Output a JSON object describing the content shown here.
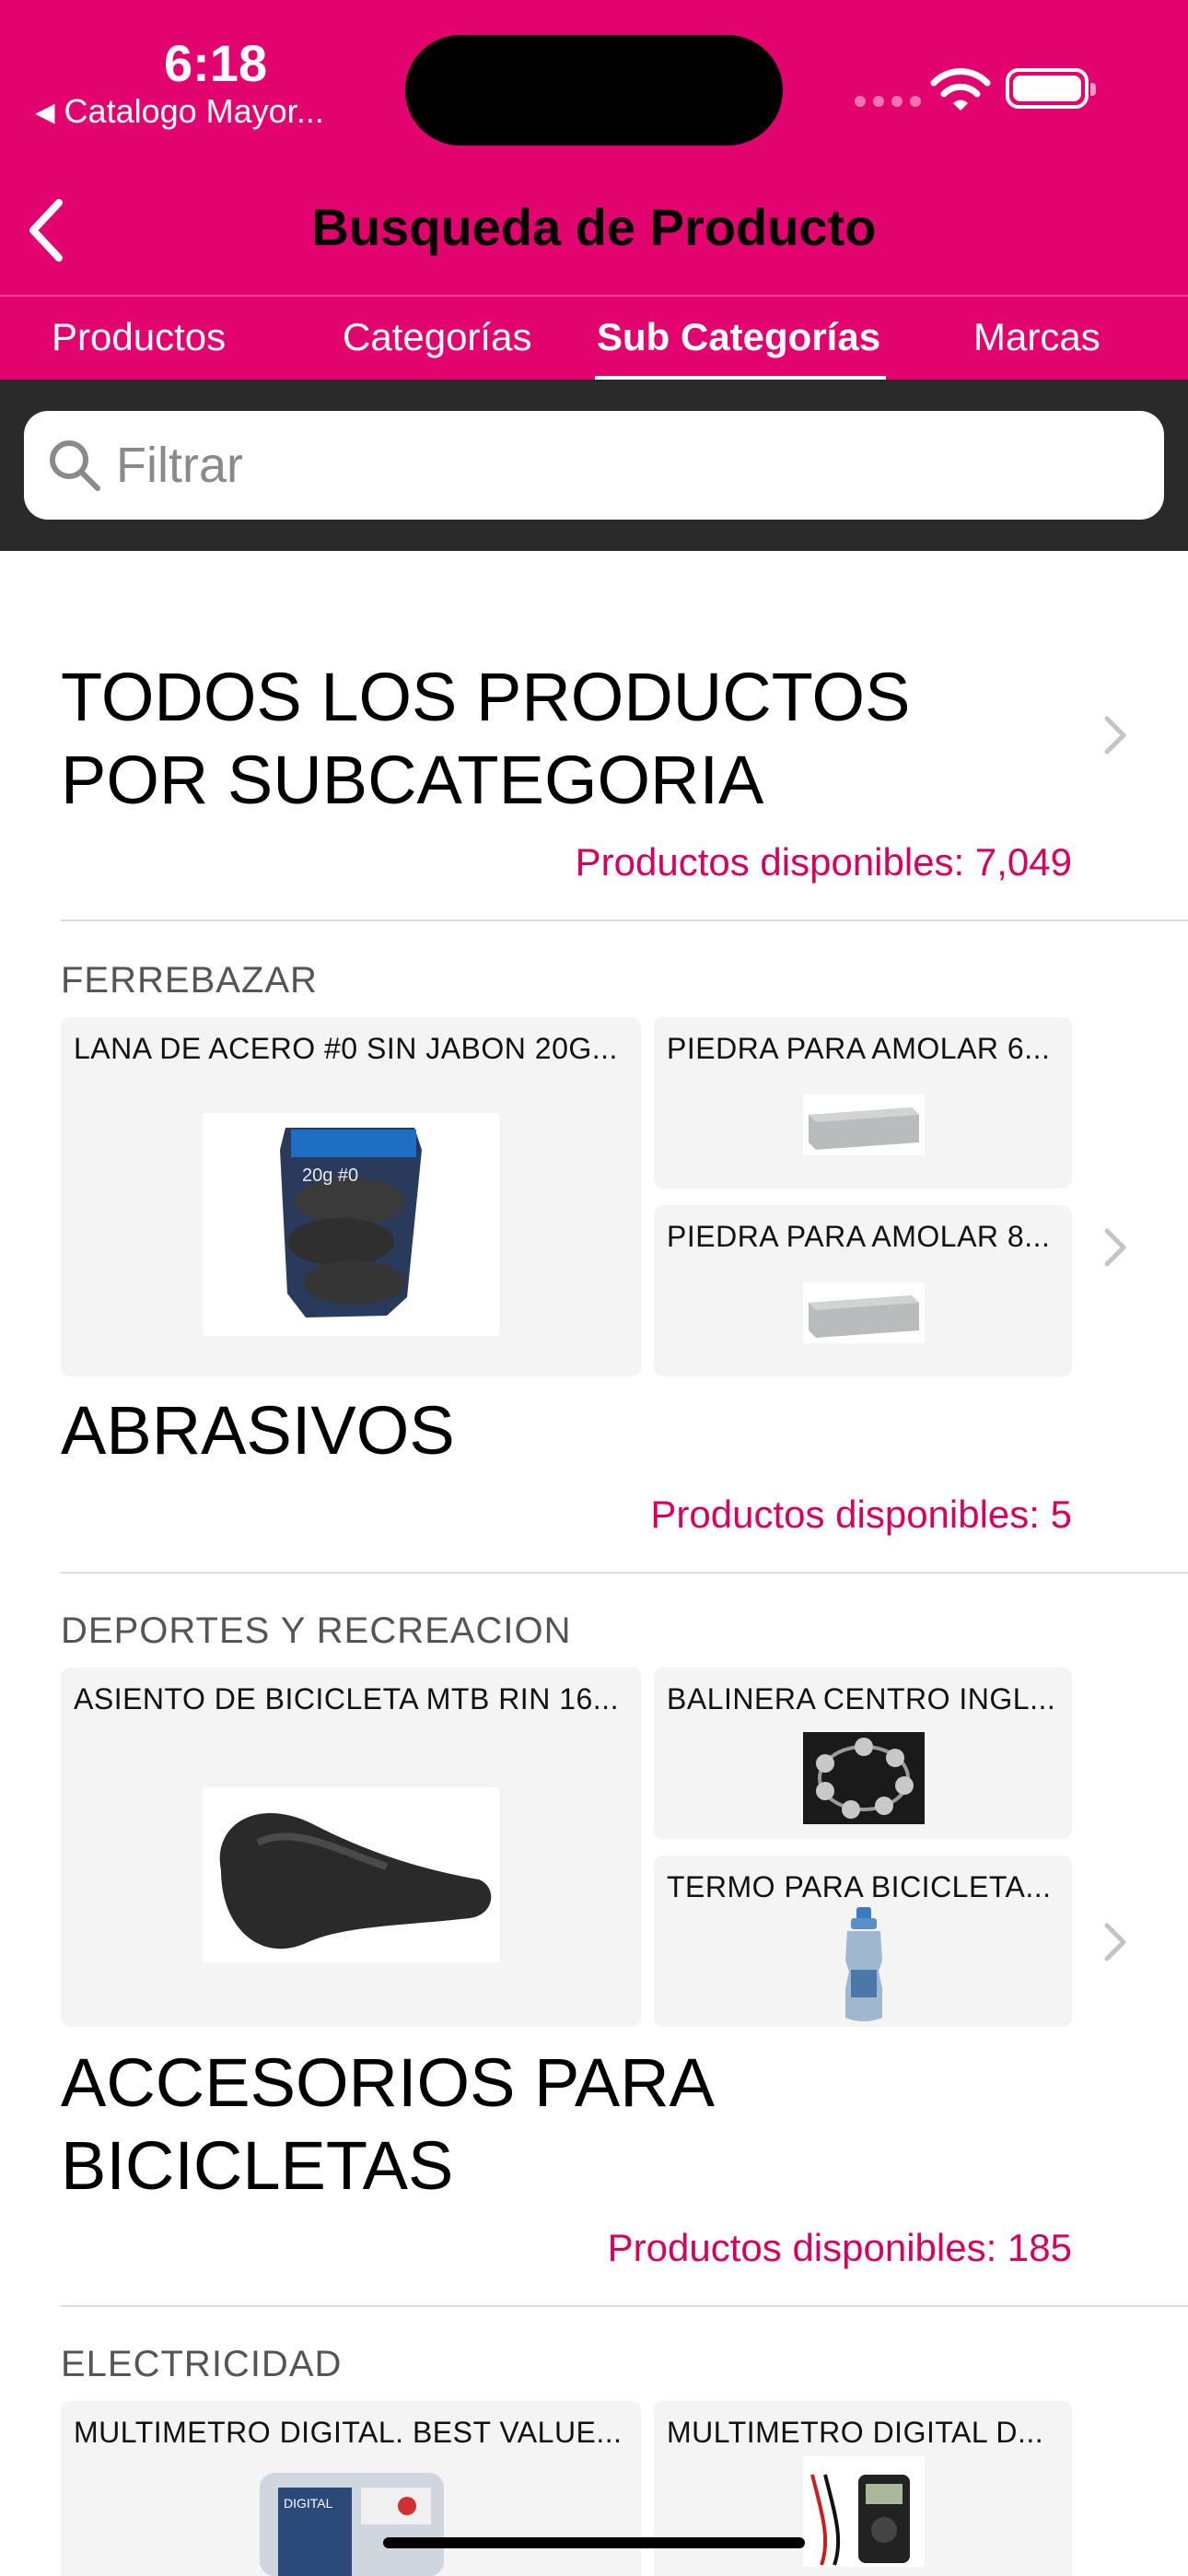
{
  "status_bar": {
    "time": "6:18",
    "back_app": "Catalogo Mayor..."
  },
  "nav": {
    "title": "Busqueda de Producto"
  },
  "tabs": [
    {
      "label": "Productos"
    },
    {
      "label": "Categorías"
    },
    {
      "label": "Sub Categorías",
      "active": true
    },
    {
      "label": "Marcas"
    }
  ],
  "search": {
    "placeholder": "Filtrar",
    "value": ""
  },
  "all_products": {
    "title": "TODOS LOS PRODUCTOS POR SUBCATEGORIA",
    "count": "Productos disponibles: 7,049"
  },
  "subcategories": [
    {
      "category": "FERREBAZAR",
      "name": "ABRASIVOS",
      "count": "Productos disponibles: 5",
      "products": [
        {
          "name": "LANA DE ACERO #0 SIN JABON 20G...",
          "icon": "steel-wool-image"
        },
        {
          "name": "PIEDRA PARA AMOLAR 6...",
          "icon": "sharpening-stone-image"
        },
        {
          "name": "PIEDRA PARA AMOLAR 8...",
          "icon": "sharpening-stone-image"
        }
      ]
    },
    {
      "category": "DEPORTES Y RECREACION",
      "name": "ACCESORIOS PARA BICICLETAS",
      "count": "Productos disponibles: 185",
      "products": [
        {
          "name": "ASIENTO DE BICICLETA MTB RIN 16...",
          "icon": "bicycle-seat-image"
        },
        {
          "name": "BALINERA CENTRO INGL...",
          "icon": "ball-bearing-image"
        },
        {
          "name": "TERMO PARA BICICLETA...",
          "icon": "water-bottle-image"
        }
      ]
    },
    {
      "category": "ELECTRICIDAD",
      "products": [
        {
          "name": "MULTIMETRO DIGITAL. BEST VALUE...",
          "icon": "multimeter-package-image"
        },
        {
          "name": "MULTIMETRO DIGITAL D...",
          "icon": "multimeter-image"
        }
      ]
    }
  ],
  "colors": {
    "brand": "#e3036f",
    "count_text": "#d6005f",
    "search_band": "#2a2a2a"
  }
}
